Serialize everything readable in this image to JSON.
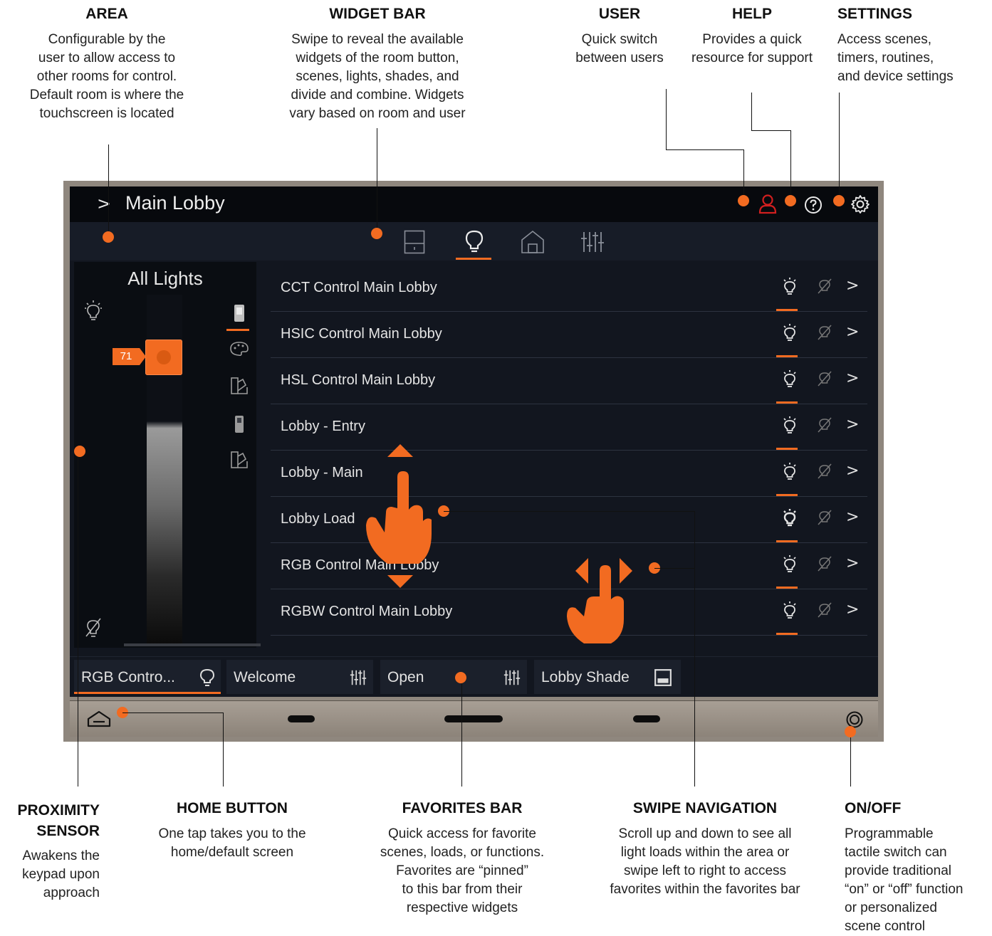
{
  "callouts": {
    "area": {
      "title": "AREA",
      "text": [
        "Configurable by the",
        "user to allow access to",
        "other rooms for control.",
        "Default room is where the",
        "touchscreen is located"
      ]
    },
    "widget_bar": {
      "title": "WIDGET BAR",
      "text": [
        "Swipe to reveal the available",
        "widgets of the room button,",
        "scenes, lights, shades, and",
        "divide and combine. Widgets",
        "vary based on room and user"
      ]
    },
    "user": {
      "title": "USER",
      "text": [
        "Quick switch",
        "between users"
      ]
    },
    "help": {
      "title": "HELP",
      "text": [
        "Provides a quick",
        "resource for support"
      ]
    },
    "settings": {
      "title": "SETTINGS",
      "text": [
        "Access scenes,",
        "timers, routines,",
        "and device settings"
      ]
    },
    "proximity": {
      "title": [
        "PROXIMITY",
        "SENSOR"
      ],
      "text": [
        "Awakens the",
        "keypad upon",
        "approach"
      ]
    },
    "home": {
      "title": "HOME BUTTON",
      "text": [
        "One tap takes you to the",
        "home/default screen"
      ]
    },
    "favorites": {
      "title": "FAVORITES BAR",
      "text": [
        "Quick access for favorite",
        "scenes, loads, or functions.",
        "Favorites are “pinned”",
        "to this bar from their",
        "respective widgets"
      ]
    },
    "swipe": {
      "title": "SWIPE NAVIGATION",
      "text": [
        "Scroll up and down to see all",
        "light loads within the area or",
        "swipe left to right to access",
        "favorites within the favorites bar"
      ]
    },
    "onoff": {
      "title": "ON/OFF",
      "text": [
        "Programmable",
        "tactile switch can",
        "provide traditional",
        "“on” or “off” function",
        "or personalized",
        "scene control"
      ]
    }
  },
  "screen": {
    "area_chevron": ">",
    "area_title": "Main Lobby",
    "panel_title": "All Lights",
    "level": "71",
    "level_fraction": 0.71,
    "loads": [
      "CCT Control Main Lobby",
      "HSIC Control Main Lobby",
      "HSL Control Main Lobby",
      "Lobby - Entry",
      "Lobby - Main",
      "Lobby Load",
      "RGB Control Main Lobby",
      "RGBW Control Main Lobby"
    ],
    "row_arrow": ">",
    "favorites": [
      {
        "label": "RGB Contro...",
        "icon": "bulb-icon",
        "selected": true
      },
      {
        "label": "Welcome",
        "icon": "sliders-icon"
      },
      {
        "label": "Open",
        "icon": "sliders-icon"
      },
      {
        "label": "Lobby Shade",
        "icon": "shade-icon"
      }
    ]
  },
  "colors": {
    "accent": "#f26b21",
    "screen_bg": "#12161f",
    "titlebar": "#07090d"
  }
}
